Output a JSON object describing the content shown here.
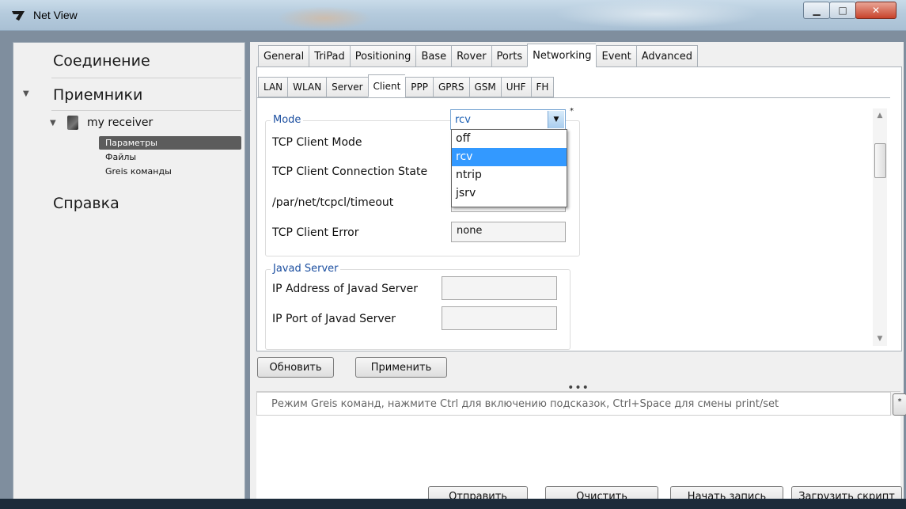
{
  "window": {
    "title": "Net View"
  },
  "sidebar": {
    "sections": [
      {
        "label": "Соединение"
      },
      {
        "label": "Приемники"
      },
      {
        "label": "Справка"
      }
    ],
    "receiver": {
      "label": "my receiver",
      "items": [
        {
          "label": "Параметры",
          "selected": true
        },
        {
          "label": "Файлы",
          "selected": false
        },
        {
          "label": "Greis команды",
          "selected": false
        }
      ]
    }
  },
  "tabs_main": [
    "General",
    "TriPad",
    "Positioning",
    "Base",
    "Rover",
    "Ports",
    "Networking",
    "Event",
    "Advanced"
  ],
  "tabs_main_active": "Networking",
  "tabs_sub": [
    "LAN",
    "WLAN",
    "Server",
    "Client",
    "PPP",
    "GPRS",
    "GSM",
    "UHF",
    "FH"
  ],
  "tabs_sub_active": "Client",
  "mode_group": {
    "title": "Mode",
    "labels": {
      "client_mode": "TCP Client Mode",
      "connection_state": "TCP Client Connection State",
      "timeout": "/par/net/tcpcl/timeout",
      "error": "TCP Client Error"
    },
    "client_mode_value": "rcv",
    "asterisk": "*",
    "error_value": "none",
    "dropdown_options": [
      "off",
      "rcv",
      "ntrip",
      "jsrv"
    ],
    "dropdown_selected": "rcv"
  },
  "javad_group": {
    "title": "Javad Server",
    "labels": {
      "ip_address": "IP Address of Javad Server",
      "ip_port": "IP Port of Javad Server"
    }
  },
  "actions": {
    "refresh": "Обновить",
    "apply": "Применить"
  },
  "splitter": "•••",
  "command": {
    "placeholder": "Режим Greis команд, нажмите  Ctrl для включению подсказок, Ctrl+Space для смены print/set",
    "side_button": "*"
  },
  "bottom_buttons": {
    "send": "Отправить",
    "clear": "Очистить",
    "start_record": "Начать запись",
    "load_script": "Загрузить скрипт"
  },
  "colors": {
    "accent": "#3399ff",
    "group_title": "#1c4fa0",
    "selected_nav": "#5c5c5c"
  }
}
